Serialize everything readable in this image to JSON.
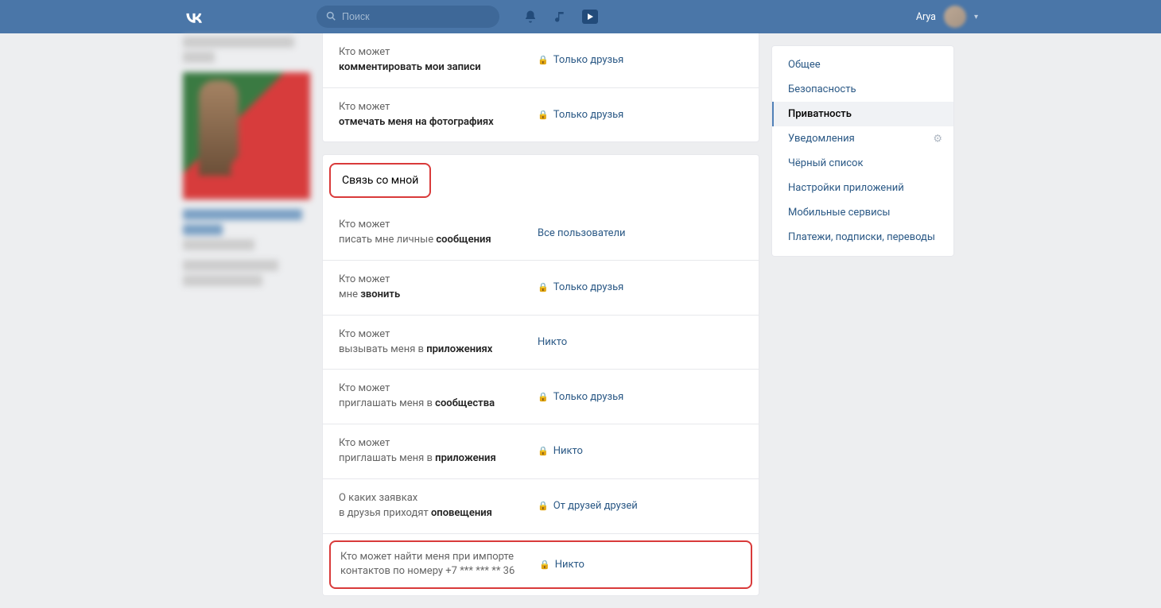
{
  "topbar": {
    "search_placeholder": "Поиск",
    "user_name": "Arya"
  },
  "main": {
    "rows_top": [
      {
        "prefix": "Кто может",
        "bold": "комментировать мои записи",
        "value": "Только друзья",
        "locked": true
      },
      {
        "prefix": "Кто может",
        "bold": "отмечать меня на фотографиях",
        "value": "Только друзья",
        "locked": true
      }
    ],
    "section_title": "Связь со мной",
    "rows_contact": [
      {
        "prefix": "Кто может",
        "mid": "писать мне личные ",
        "bold": "сообщения",
        "value": "Все пользователи",
        "locked": false
      },
      {
        "prefix": "Кто может",
        "mid": "мне ",
        "bold": "звонить",
        "value": "Только друзья",
        "locked": true
      },
      {
        "prefix": "Кто может",
        "mid": "вызывать меня в ",
        "bold": "приложениях",
        "value": "Никто",
        "locked": false
      },
      {
        "prefix": "Кто может",
        "mid": "приглашать меня в ",
        "bold": "сообщества",
        "value": "Только друзья",
        "locked": true
      },
      {
        "prefix": "Кто может",
        "mid": "приглашать меня в ",
        "bold": "приложения",
        "value": "Никто",
        "locked": true
      },
      {
        "prefix": "О каких заявках",
        "mid": "в друзья приходят ",
        "bold": "оповещения",
        "value": "От друзей друзей",
        "locked": true
      }
    ],
    "highlighted_row": {
      "label": "Кто может найти меня при импорте контактов по номеру +7 *** *** ** 36",
      "value": "Никто",
      "locked": true
    }
  },
  "sidebar": {
    "items": [
      {
        "label": "Общее",
        "active": false
      },
      {
        "label": "Безопасность",
        "active": false
      },
      {
        "label": "Приватность",
        "active": true
      },
      {
        "label": "Уведомления",
        "active": false,
        "gear": true
      },
      {
        "label": "Чёрный список",
        "active": false
      },
      {
        "label": "Настройки приложений",
        "active": false
      },
      {
        "label": "Мобильные сервисы",
        "active": false
      },
      {
        "label": "Платежи, подписки, переводы",
        "active": false
      }
    ]
  }
}
